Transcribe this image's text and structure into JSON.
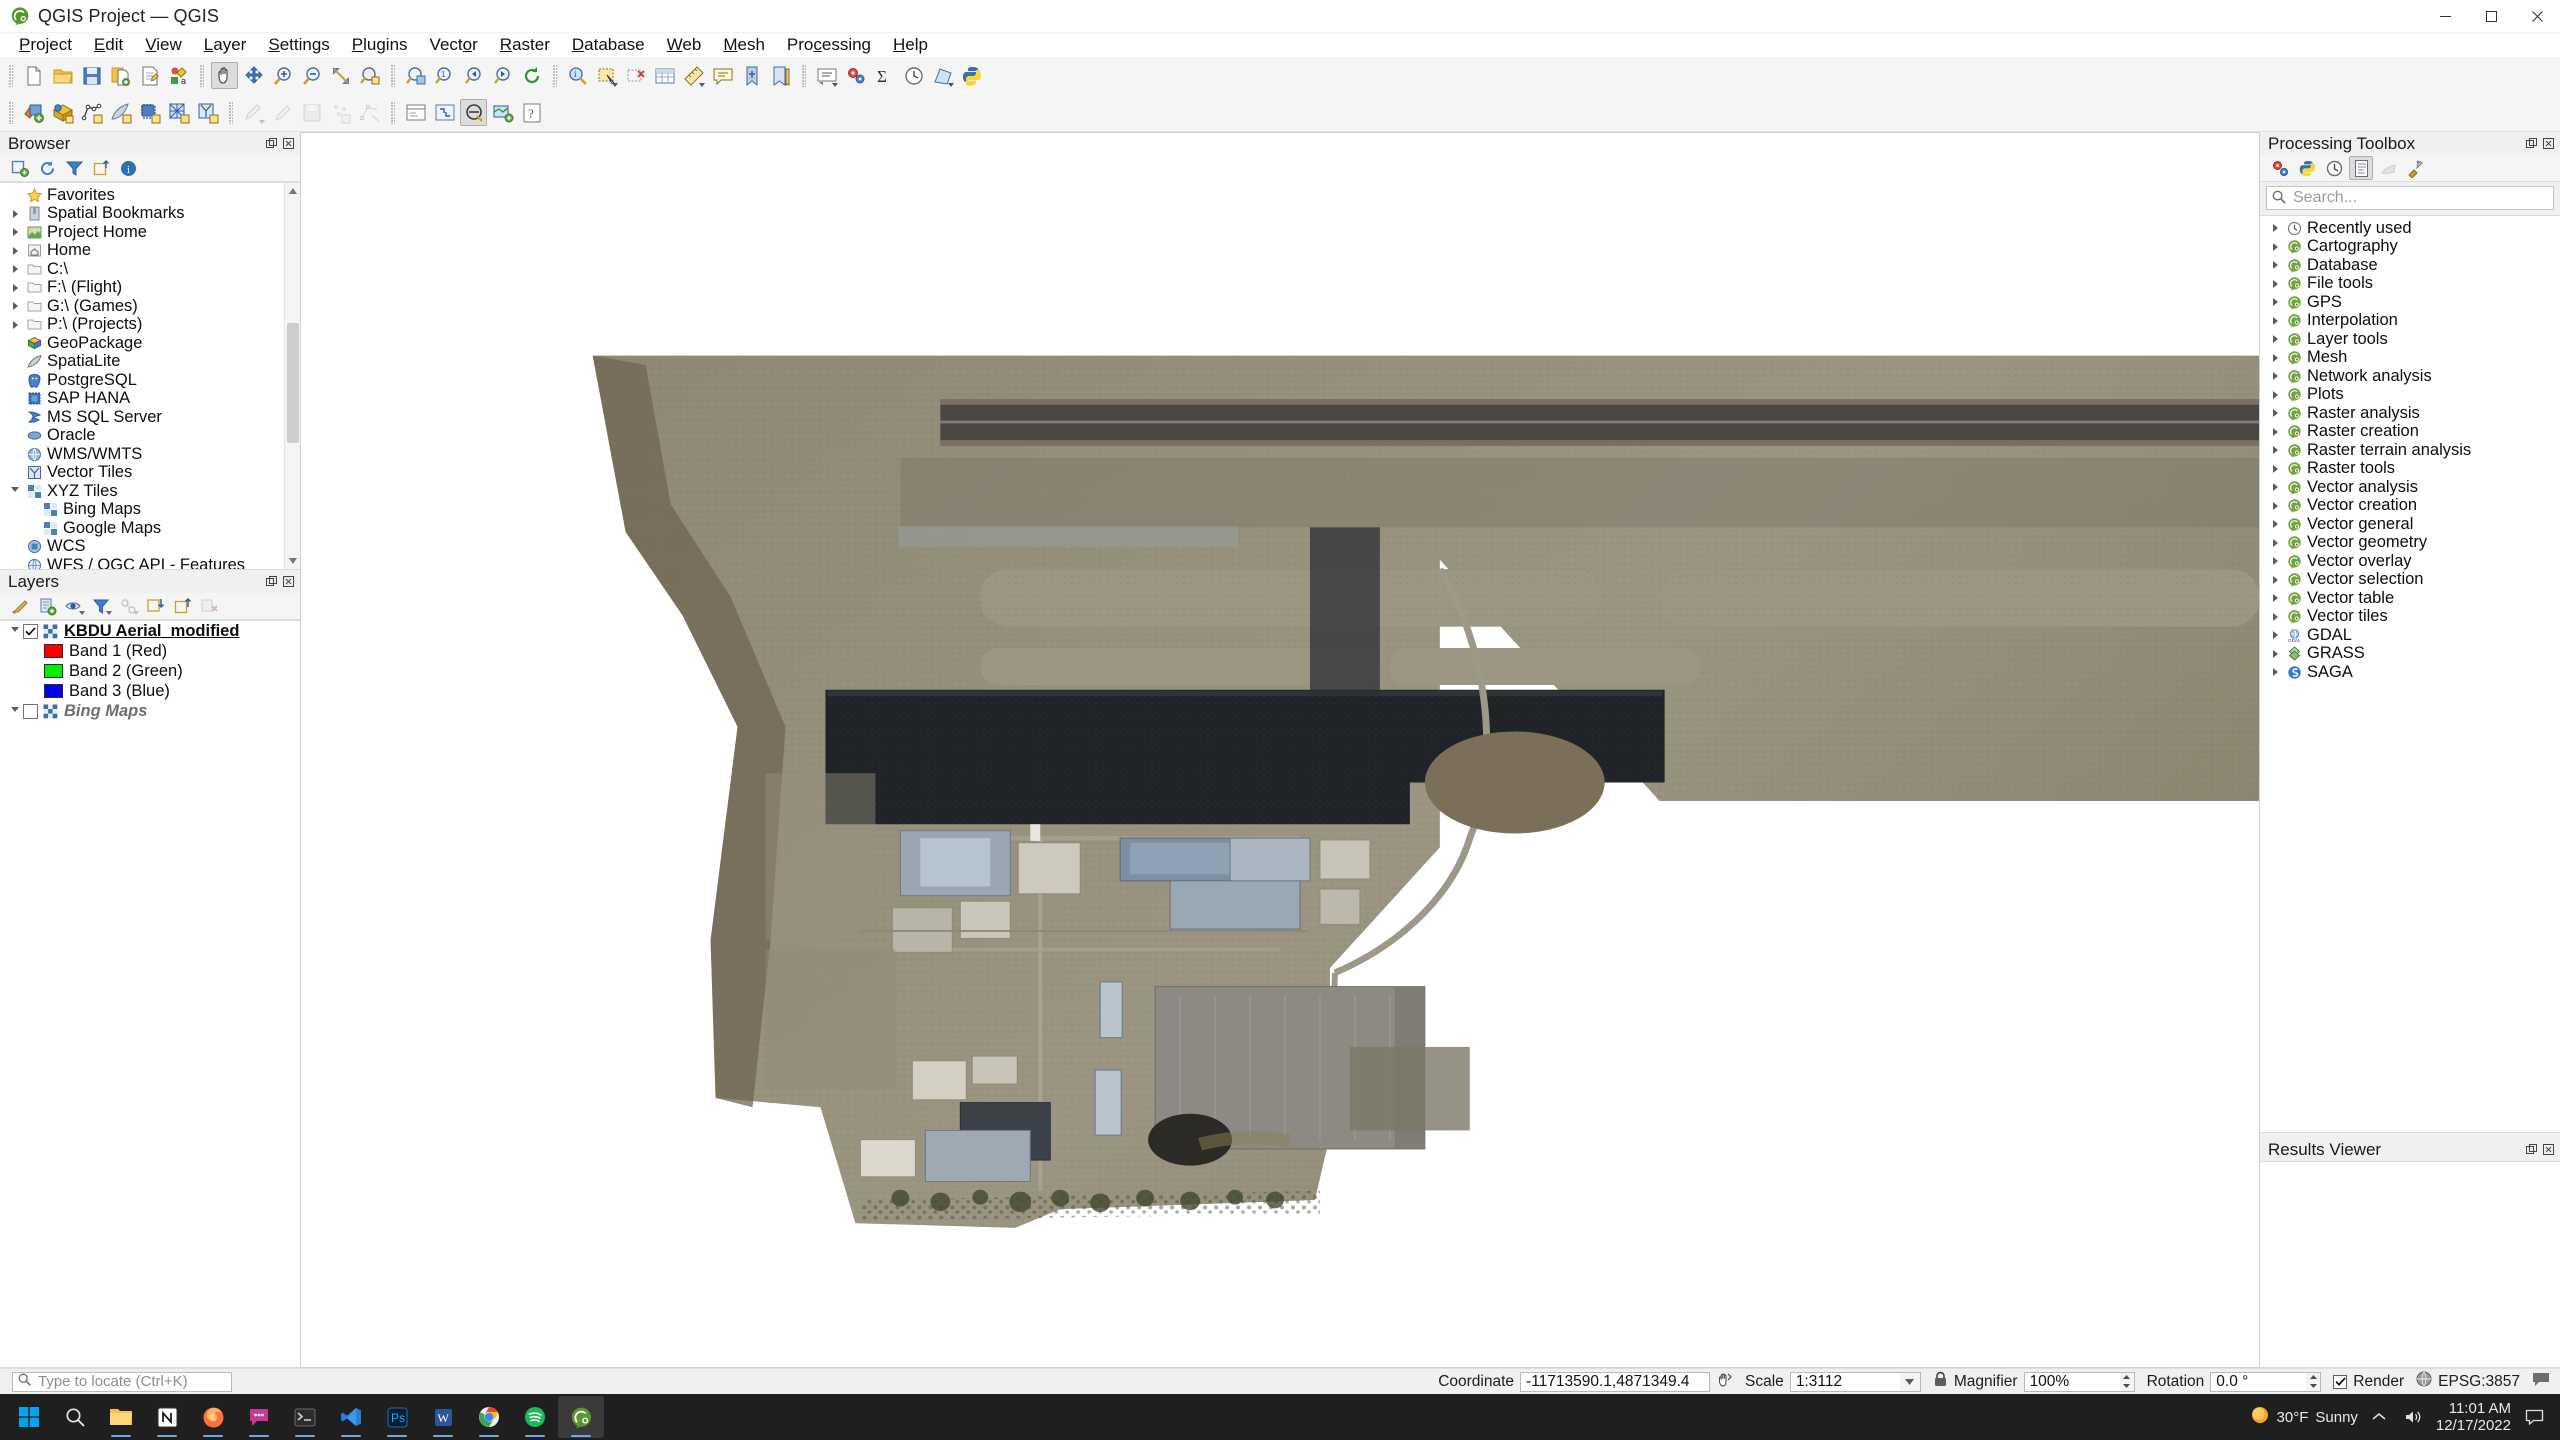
{
  "window": {
    "title": "QGIS Project — QGIS",
    "app_icon": "qgis-logo-icon",
    "minimize": "minimize-icon",
    "maximize": "maximize-icon",
    "close": "close-icon"
  },
  "menubar": [
    {
      "label": "Project",
      "accel": "P"
    },
    {
      "label": "Edit",
      "accel": "E"
    },
    {
      "label": "View",
      "accel": "V"
    },
    {
      "label": "Layer",
      "accel": "L"
    },
    {
      "label": "Settings",
      "accel": "S"
    },
    {
      "label": "Plugins",
      "accel": "P"
    },
    {
      "label": "Vector",
      "accel": "o"
    },
    {
      "label": "Raster",
      "accel": "R"
    },
    {
      "label": "Database",
      "accel": "D"
    },
    {
      "label": "Web",
      "accel": "W"
    },
    {
      "label": "Mesh",
      "accel": "M"
    },
    {
      "label": "Processing",
      "accel": "c"
    },
    {
      "label": "Help",
      "accel": "H"
    }
  ],
  "toolbar_row1": [
    {
      "name": "new-project-button",
      "icon": "new-document-icon"
    },
    {
      "name": "open-project-button",
      "icon": "open-folder-icon"
    },
    {
      "name": "save-project-button",
      "icon": "save-disk-icon"
    },
    {
      "name": "save-project-as-button",
      "icon": "save-as-icon"
    },
    {
      "name": "new-print-layout-button",
      "icon": "layout-designer-icon"
    },
    {
      "name": "style-manager-button",
      "icon": "style-manager-icon"
    },
    {
      "name": "pan-map-button",
      "icon": "pan-hand-icon",
      "state": "active"
    },
    {
      "name": "pan-to-selection-button",
      "icon": "pan-selection-icon"
    },
    {
      "name": "zoom-in-button",
      "icon": "zoom-in-icon"
    },
    {
      "name": "zoom-out-button",
      "icon": "zoom-out-icon"
    },
    {
      "name": "zoom-full-button",
      "icon": "zoom-full-icon"
    },
    {
      "name": "zoom-selection-button",
      "icon": "zoom-to-selection-icon"
    },
    {
      "name": "zoom-to-layer-button",
      "icon": "zoom-to-layer-icon"
    },
    {
      "name": "zoom-native-button",
      "icon": "zoom-native-icon"
    },
    {
      "name": "zoom-last-button",
      "icon": "zoom-last-icon"
    },
    {
      "name": "zoom-next-button",
      "icon": "zoom-next-icon"
    },
    {
      "name": "refresh-button",
      "icon": "refresh-icon"
    },
    {
      "name": "identify-features-button",
      "icon": "identify-icon"
    },
    {
      "name": "select-features-button",
      "icon": "select-rect-icon"
    },
    {
      "name": "deselect-features-button",
      "icon": "deselect-icon"
    },
    {
      "name": "open-attribute-table-button",
      "icon": "attribute-table-icon"
    },
    {
      "name": "measure-line-button",
      "icon": "measure-icon"
    },
    {
      "name": "show-map-tips-button",
      "icon": "map-tips-icon"
    },
    {
      "name": "new-bookmark-button",
      "icon": "bookmark-icon"
    },
    {
      "name": "show-bookmarks-button",
      "icon": "bookmarks-list-icon"
    },
    {
      "name": "text-annotation-button",
      "icon": "text-annotation-icon"
    },
    {
      "name": "processing-toolbox-button",
      "icon": "processing-gears-icon"
    },
    {
      "name": "statistical-summary-button",
      "icon": "sigma-icon"
    },
    {
      "name": "temporal-controller-button",
      "icon": "clock-icon"
    },
    {
      "name": "measure-area-button",
      "icon": "measure-area-icon"
    },
    {
      "name": "python-console-button",
      "icon": "python-icon"
    }
  ],
  "toolbar_row2": [
    {
      "name": "add-vector-layer-button",
      "icon": "add-vector-layer-icon"
    },
    {
      "name": "add-raster-layer-button",
      "icon": "add-raster-layer-icon"
    },
    {
      "name": "add-delimited-text-layer-button",
      "icon": "add-delimited-text-icon"
    },
    {
      "name": "add-spatialite-layer-button",
      "icon": "add-spatialite-icon"
    },
    {
      "name": "add-postgis-layer-button",
      "icon": "add-postgis-icon"
    },
    {
      "name": "add-mesh-layer-button",
      "icon": "add-mesh-layer-icon"
    },
    {
      "name": "add-vector-tile-layer-button",
      "icon": "add-vector-tile-icon"
    },
    {
      "name": "current-edits-button",
      "icon": "current-edits-icon",
      "state": "disabled"
    },
    {
      "name": "toggle-editing-button",
      "icon": "pencil-icon",
      "state": "disabled"
    },
    {
      "name": "save-layer-edits-button",
      "icon": "save-edits-icon",
      "state": "disabled"
    },
    {
      "name": "add-point-feature-button",
      "icon": "add-point-icon",
      "state": "disabled"
    },
    {
      "name": "vertex-tool-button",
      "icon": "vertex-tool-icon",
      "state": "disabled"
    },
    {
      "name": "modify-attributes-button",
      "icon": "modify-attributes-icon",
      "state": "disabled"
    },
    {
      "name": "delete-selected-button",
      "icon": "delete-selected-icon",
      "state": "disabled"
    },
    {
      "name": "cut-features-button",
      "icon": "cut-icon",
      "state": "disabled"
    },
    {
      "name": "copy-features-button",
      "icon": "copy-icon",
      "state": "disabled"
    },
    {
      "name": "paste-features-button",
      "icon": "paste-icon",
      "state": "disabled"
    },
    {
      "name": "undo-button",
      "icon": "undo-icon",
      "state": "disabled"
    },
    {
      "name": "redo-button",
      "icon": "redo-icon",
      "state": "disabled"
    },
    {
      "name": "select-value-button",
      "icon": "select-value-icon"
    },
    {
      "name": "zoom-full-extent-button",
      "icon": "zoom-extent-icon"
    },
    {
      "name": "map-tips-toggle-button",
      "icon": "maptip-toggle-icon",
      "state": "active"
    },
    {
      "name": "new-map-view-button",
      "icon": "new-map-view-icon"
    },
    {
      "name": "help-contents-button",
      "icon": "help-icon"
    }
  ],
  "browser": {
    "title": "Browser",
    "toolbar": [
      {
        "name": "add-selected-layers-button",
        "icon": "add-layer-icon"
      },
      {
        "name": "refresh-browser-button",
        "icon": "refresh-icon"
      },
      {
        "name": "filter-browser-button",
        "icon": "filter-funnel-icon"
      },
      {
        "name": "collapse-all-button",
        "icon": "collapse-all-icon"
      },
      {
        "name": "enable-properties-widget-button",
        "icon": "info-icon"
      }
    ],
    "items": [
      {
        "label": "Favorites",
        "icon": "star-icon",
        "expandable": false,
        "indent": 0
      },
      {
        "label": "Spatial Bookmarks",
        "icon": "bookmark-book-icon",
        "expandable": true,
        "indent": 0
      },
      {
        "label": "Project Home",
        "icon": "project-home-icon",
        "expandable": true,
        "indent": 0
      },
      {
        "label": "Home",
        "icon": "home-icon",
        "expandable": true,
        "indent": 0
      },
      {
        "label": "C:\\",
        "icon": "folder-icon",
        "expandable": true,
        "indent": 0
      },
      {
        "label": "F:\\ (Flight)",
        "icon": "folder-icon",
        "expandable": true,
        "indent": 0
      },
      {
        "label": "G:\\ (Games)",
        "icon": "folder-icon",
        "expandable": true,
        "indent": 0
      },
      {
        "label": "P:\\ (Projects)",
        "icon": "folder-icon",
        "expandable": true,
        "indent": 0
      },
      {
        "label": "GeoPackage",
        "icon": "geopackage-icon",
        "expandable": false,
        "indent": 0
      },
      {
        "label": "SpatiaLite",
        "icon": "spatialite-icon",
        "expandable": false,
        "indent": 0
      },
      {
        "label": "PostgreSQL",
        "icon": "postgres-icon",
        "expandable": false,
        "indent": 0
      },
      {
        "label": "SAP HANA",
        "icon": "saphana-icon",
        "expandable": false,
        "indent": 0
      },
      {
        "label": "MS SQL Server",
        "icon": "mssql-icon",
        "expandable": false,
        "indent": 0
      },
      {
        "label": "Oracle",
        "icon": "oracle-icon",
        "expandable": false,
        "indent": 0
      },
      {
        "label": "WMS/WMTS",
        "icon": "wms-icon",
        "expandable": false,
        "indent": 0
      },
      {
        "label": "Vector Tiles",
        "icon": "vector-tiles-icon",
        "expandable": false,
        "indent": 0
      },
      {
        "label": "XYZ Tiles",
        "icon": "xyz-tiles-icon",
        "expandable": true,
        "expanded": true,
        "indent": 0
      },
      {
        "label": "Bing Maps",
        "icon": "xyz-tiles-icon",
        "expandable": false,
        "indent": 1
      },
      {
        "label": "Google Maps",
        "icon": "xyz-tiles-icon",
        "expandable": false,
        "indent": 1
      },
      {
        "label": "WCS",
        "icon": "wcs-icon",
        "expandable": false,
        "indent": 0
      },
      {
        "label": "WFS / OGC API - Features",
        "icon": "wfs-icon",
        "expandable": false,
        "indent": 0
      }
    ]
  },
  "layers": {
    "title": "Layers",
    "toolbar": [
      {
        "name": "open-layer-styling-button",
        "icon": "styling-brush-icon"
      },
      {
        "name": "add-group-button",
        "icon": "add-group-icon"
      },
      {
        "name": "manage-layer-visibility-button",
        "icon": "eye-icon"
      },
      {
        "name": "filter-legend-button",
        "icon": "filter-funnel-icon"
      },
      {
        "name": "filter-legend-expression-button",
        "icon": "filter-expression-icon",
        "state": "disabled"
      },
      {
        "name": "expand-all-button",
        "icon": "expand-all-icon"
      },
      {
        "name": "collapse-all-button",
        "icon": "collapse-all-icon"
      },
      {
        "name": "remove-layer-button",
        "icon": "remove-layer-icon",
        "state": "disabled"
      }
    ],
    "items": [
      {
        "label": "KBDU Aerial_modified",
        "type": "raster",
        "checked": true,
        "expanded": true,
        "style": "bold"
      },
      {
        "label": "Band 1 (Red)",
        "type": "band",
        "color": "#ff0000"
      },
      {
        "label": "Band 2 (Green)",
        "type": "band",
        "color": "#00ee00"
      },
      {
        "label": "Band 3 (Blue)",
        "type": "band",
        "color": "#0000ee"
      },
      {
        "label": "Bing Maps",
        "type": "raster",
        "checked": false,
        "expanded": true,
        "style": "italic"
      }
    ]
  },
  "processing": {
    "title": "Processing Toolbox",
    "toolbar": [
      {
        "name": "run-model-button",
        "icon": "processing-gears-icon"
      },
      {
        "name": "python-script-button",
        "icon": "python-icon"
      },
      {
        "name": "history-button",
        "icon": "clock-icon"
      },
      {
        "name": "results-viewer-button",
        "icon": "results-document-icon",
        "state": "active"
      },
      {
        "name": "edit-model-button",
        "icon": "model-icon",
        "state": "disabled"
      },
      {
        "name": "options-button",
        "icon": "wrench-icon"
      }
    ],
    "search_placeholder": "Search...",
    "search_value": "",
    "items": [
      {
        "label": "Recently used",
        "icon": "clock-icon"
      },
      {
        "label": "Cartography",
        "icon": "qgis-alg-icon"
      },
      {
        "label": "Database",
        "icon": "qgis-alg-icon"
      },
      {
        "label": "File tools",
        "icon": "qgis-alg-icon"
      },
      {
        "label": "GPS",
        "icon": "qgis-alg-icon"
      },
      {
        "label": "Interpolation",
        "icon": "qgis-alg-icon"
      },
      {
        "label": "Layer tools",
        "icon": "qgis-alg-icon"
      },
      {
        "label": "Mesh",
        "icon": "qgis-alg-icon"
      },
      {
        "label": "Network analysis",
        "icon": "qgis-alg-icon"
      },
      {
        "label": "Plots",
        "icon": "qgis-alg-icon"
      },
      {
        "label": "Raster analysis",
        "icon": "qgis-alg-icon"
      },
      {
        "label": "Raster creation",
        "icon": "qgis-alg-icon"
      },
      {
        "label": "Raster terrain analysis",
        "icon": "qgis-alg-icon"
      },
      {
        "label": "Raster tools",
        "icon": "qgis-alg-icon"
      },
      {
        "label": "Vector analysis",
        "icon": "qgis-alg-icon"
      },
      {
        "label": "Vector creation",
        "icon": "qgis-alg-icon"
      },
      {
        "label": "Vector general",
        "icon": "qgis-alg-icon"
      },
      {
        "label": "Vector geometry",
        "icon": "qgis-alg-icon"
      },
      {
        "label": "Vector overlay",
        "icon": "qgis-alg-icon"
      },
      {
        "label": "Vector selection",
        "icon": "qgis-alg-icon"
      },
      {
        "label": "Vector table",
        "icon": "qgis-alg-icon"
      },
      {
        "label": "Vector tiles",
        "icon": "qgis-alg-icon"
      },
      {
        "label": "GDAL",
        "icon": "gdal-icon"
      },
      {
        "label": "GRASS",
        "icon": "grass-icon"
      },
      {
        "label": "SAGA",
        "icon": "saga-icon"
      }
    ]
  },
  "results_viewer": {
    "title": "Results Viewer"
  },
  "statusbar": {
    "locate_placeholder": "Type to locate (Ctrl+K)",
    "locate_value": "",
    "coordinate_label": "Coordinate",
    "coordinate_value": "-11713590.1,4871349.4",
    "scale_label": "Scale",
    "scale_value": "1:3112",
    "magnifier_label": "Magnifier",
    "magnifier_value": "100%",
    "rotation_label": "Rotation",
    "rotation_value": "0.0 °",
    "render_label": "Render",
    "render_checked": true,
    "crs_label": "EPSG:3857",
    "messages_icon": "message-bubble-icon",
    "lock_icon": "lock-icon",
    "toggle_extents_icon": "toggle-extents-icon"
  },
  "taskbar": {
    "items": [
      {
        "name": "start-button",
        "icon": "windows-logo-icon"
      },
      {
        "name": "search-button",
        "icon": "search-icon"
      },
      {
        "name": "file-explorer-button",
        "icon": "folder-icon",
        "running": true
      },
      {
        "name": "notion-button",
        "icon": "notion-icon",
        "running": true
      },
      {
        "name": "firefox-button",
        "icon": "firefox-icon",
        "running": true
      },
      {
        "name": "chat-button",
        "icon": "chat-icon",
        "running": true
      },
      {
        "name": "terminal-button",
        "icon": "terminal-icon",
        "running": true
      },
      {
        "name": "vscode-button",
        "icon": "vscode-icon",
        "running": true
      },
      {
        "name": "photoshop-button",
        "icon": "photoshop-icon",
        "running": true
      },
      {
        "name": "word-button",
        "icon": "word-icon",
        "running": true
      },
      {
        "name": "chrome-button",
        "icon": "chrome-icon",
        "running": true
      },
      {
        "name": "spotify-button",
        "icon": "spotify-icon",
        "running": true
      },
      {
        "name": "qgis-taskbar-button",
        "icon": "qgis-logo-icon",
        "running": true,
        "active": true
      }
    ],
    "weather_temp": "30°F",
    "weather_desc": "Sunny",
    "weather_icon": "sun-icon",
    "show_hidden_icon": "chevron-up-icon",
    "volume_icon": "speaker-icon",
    "time": "11:01 AM",
    "date": "12/17/2022",
    "notifications_icon": "notification-icon"
  },
  "map": {
    "layer_name": "KBDU Aerial_modified",
    "description": "Aerial orthophoto of KBDU airport with runway, taxiways, apron and hangars"
  },
  "colors": {
    "accent": "#589632",
    "selection": "#e7eef7",
    "panel_bg": "#f0f0f0",
    "canvas_bg": "#ffffff",
    "taskbar_bg": "#1f1f1f"
  }
}
